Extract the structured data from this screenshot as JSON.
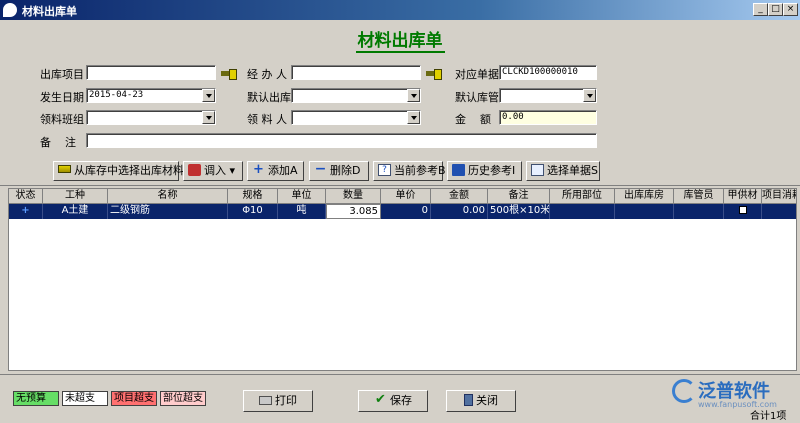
{
  "window": {
    "title": "材料出库单",
    "controls": [
      "_",
      "□",
      "×"
    ]
  },
  "form": {
    "heading": "材料出库单",
    "fields": {
      "out_project": {
        "label": "出库项目",
        "value": ""
      },
      "handler": {
        "label": "经 办 人",
        "value": ""
      },
      "document_no": {
        "label": "对应单据",
        "value": "CLCKD100000010"
      },
      "issue_date": {
        "label": "发生日期",
        "value": "2015-04-23"
      },
      "default_out": {
        "label": "默认出库",
        "value": ""
      },
      "default_keeper": {
        "label": "默认库管",
        "value": ""
      },
      "team": {
        "label": "领料班组",
        "value": ""
      },
      "receiver": {
        "label": "领 料 人",
        "value": ""
      },
      "amount": {
        "label": "金    额",
        "value": "0.00"
      },
      "remark": {
        "label": "备    注",
        "value": ""
      }
    }
  },
  "toolbar": {
    "select_stock": "从库存中选择出库材料",
    "import": "调入",
    "add": "添加A",
    "delete": "删除D",
    "current_ref": "当前参考B",
    "history_ref": "历史参考I",
    "select_doc": "选择单据S"
  },
  "grid": {
    "headers": [
      "状态",
      "工种",
      "名称",
      "规格",
      "单位",
      "数量",
      "单价",
      "金额",
      "备注",
      "所用部位",
      "出库库房",
      "库管员",
      "甲供材",
      "项目消耗"
    ],
    "rows": [
      {
        "status": "+",
        "work_type": "A土建",
        "name": "二级钢筋",
        "spec": "Φ10",
        "unit": "吨",
        "quantity": "3.085",
        "price": "0",
        "amount": "0.00",
        "remark": "500根×10米",
        "part": "",
        "warehouse": "",
        "keeper": "",
        "supplied": false,
        "consume": ""
      }
    ]
  },
  "legend": {
    "no_budget": "无预算",
    "not_over": "未超支",
    "project_over": "项目超支",
    "part_over": "部位超支"
  },
  "colors": {
    "no_budget": "#66dd66",
    "not_over": "#ffffff",
    "project_over": "#ff7070",
    "part_over": "#ffcccc",
    "heading": "#007a00",
    "selection": "#0a246a"
  },
  "footer": {
    "print": "打印",
    "save": "保存",
    "close": "关闭",
    "total": "合计1项"
  },
  "brand": {
    "name": "泛普软件",
    "url": "www.fanpusoft.com"
  }
}
